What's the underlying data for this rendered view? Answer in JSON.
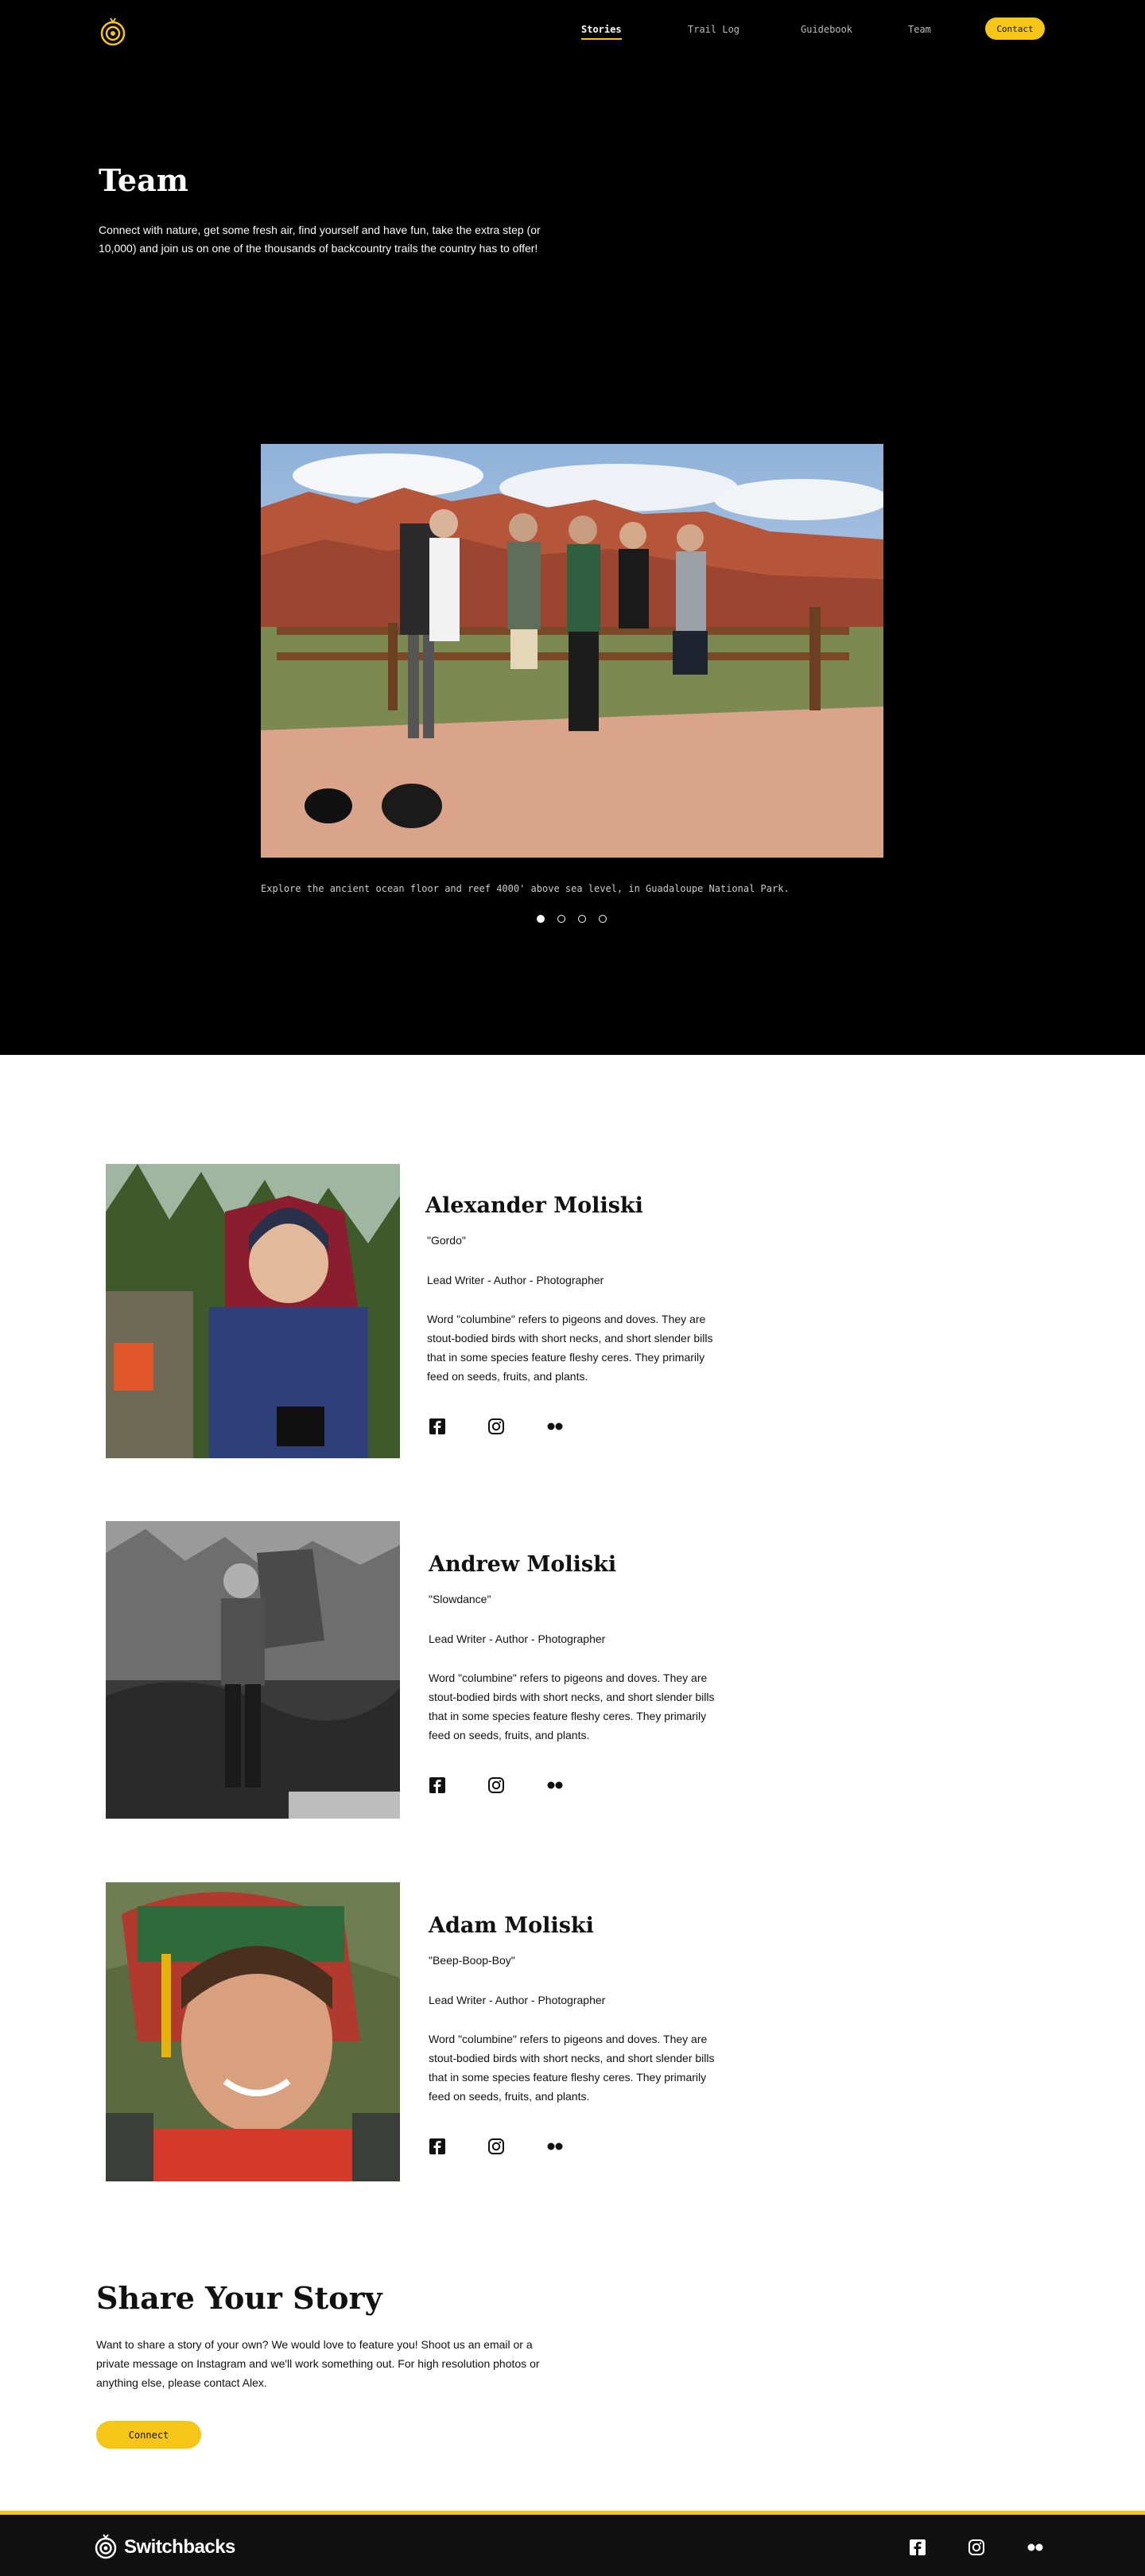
{
  "nav": {
    "links": [
      "Stories",
      "Trail Log",
      "Guidebook",
      "Team"
    ],
    "contact_label": "Contact"
  },
  "hero": {
    "title": "Team",
    "text": "Connect with nature, get some fresh air, find yourself and have fun, take the extra step (or 10,000) and join us on one of the thousands of backcountry trails the country has to offer!",
    "caption": "Explore the ancient ocean floor and reef 4000' above sea level, in Guadaloupe National Park.",
    "carousel": {
      "count": 4,
      "active_index": 0
    }
  },
  "team": [
    {
      "name": "Alexander Moliski",
      "nickname": "\"Gordo\"",
      "role": "Lead Writer - Author - Photographer",
      "bio": "Word \"columbine\" refers to pigeons and doves. They are stout-bodied birds with short necks, and short slender bills that in some species feature fleshy ceres. They primarily feed on seeds, fruits, and plants."
    },
    {
      "name": "Andrew Moliski",
      "nickname": "\"Slowdance\"",
      "role": "Lead Writer - Author - Photographer",
      "bio": "Word \"columbine\" refers to pigeons and doves. They are stout-bodied birds with short necks, and short slender bills that in some species feature fleshy ceres. They primarily feed on seeds, fruits, and plants."
    },
    {
      "name": "Adam Moliski",
      "nickname": "\"Beep-Boop-Boy\"",
      "role": "Lead Writer - Author - Photographer",
      "bio": "Word \"columbine\" refers to pigeons and doves. They are stout-bodied birds with short necks, and short slender bills that in some species feature fleshy ceres. They primarily feed on seeds, fruits, and plants."
    }
  ],
  "share": {
    "title": "Share Your Story",
    "text": "Want to share a story of your own? We would love to feature you! Shoot us an email or a private message on Instagram and we'll work something out. For high resolution photos or anything else, please contact Alex.",
    "button_label": "Connect"
  },
  "footer": {
    "brand": "Switchbacks"
  },
  "colors": {
    "accent": "#f5c518",
    "hero_bg": "#000000",
    "footer_bg": "#111111"
  },
  "icons": [
    "facebook-icon",
    "instagram-icon",
    "flickr-icon"
  ]
}
